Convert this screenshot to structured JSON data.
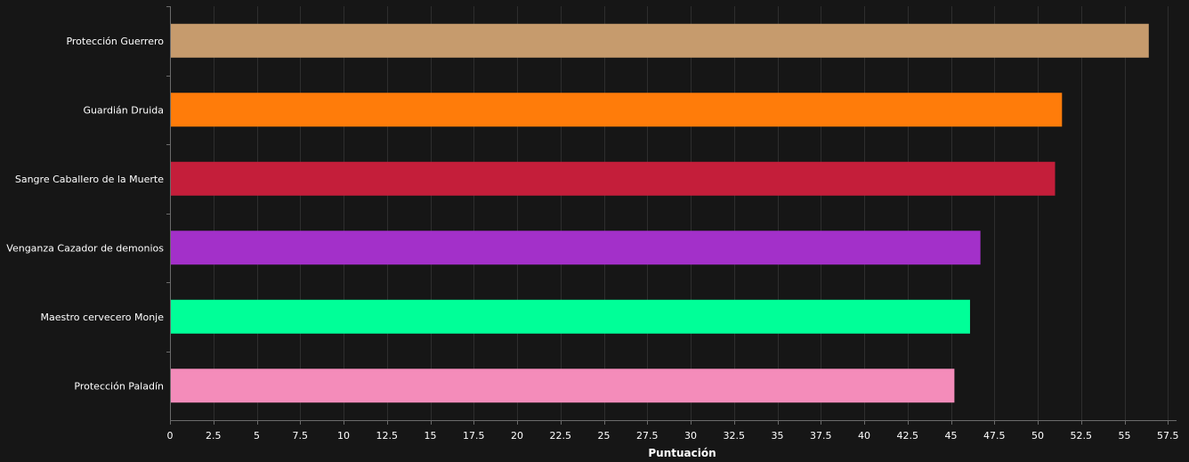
{
  "chart_data": {
    "type": "bar",
    "orientation": "horizontal",
    "categories": [
      "Protección Guerrero",
      "Guardián Druida",
      "Sangre Caballero de la Muerte",
      "Venganza Cazador de demonios",
      "Maestro cervecero Monje",
      "Protección Paladín"
    ],
    "values": [
      56.4,
      51.4,
      51.0,
      46.7,
      46.1,
      45.2
    ],
    "colors": [
      "#c69b6d",
      "#ff7c0a",
      "#c41e3a",
      "#a330c9",
      "#00ff98",
      "#f48cba"
    ],
    "xlabel": "Puntuación",
    "ylabel": "",
    "xlim": [
      0,
      58
    ],
    "xticks": [
      "0",
      "2.5",
      "5",
      "7.5",
      "10",
      "12.5",
      "15",
      "17.5",
      "20",
      "22.5",
      "25",
      "27.5",
      "30",
      "32.5",
      "35",
      "37.5",
      "40",
      "42.5",
      "45",
      "47.5",
      "50",
      "52.5",
      "55",
      "57.5"
    ],
    "grid": true,
    "background": "#161616",
    "text_color": "#ffffff"
  }
}
